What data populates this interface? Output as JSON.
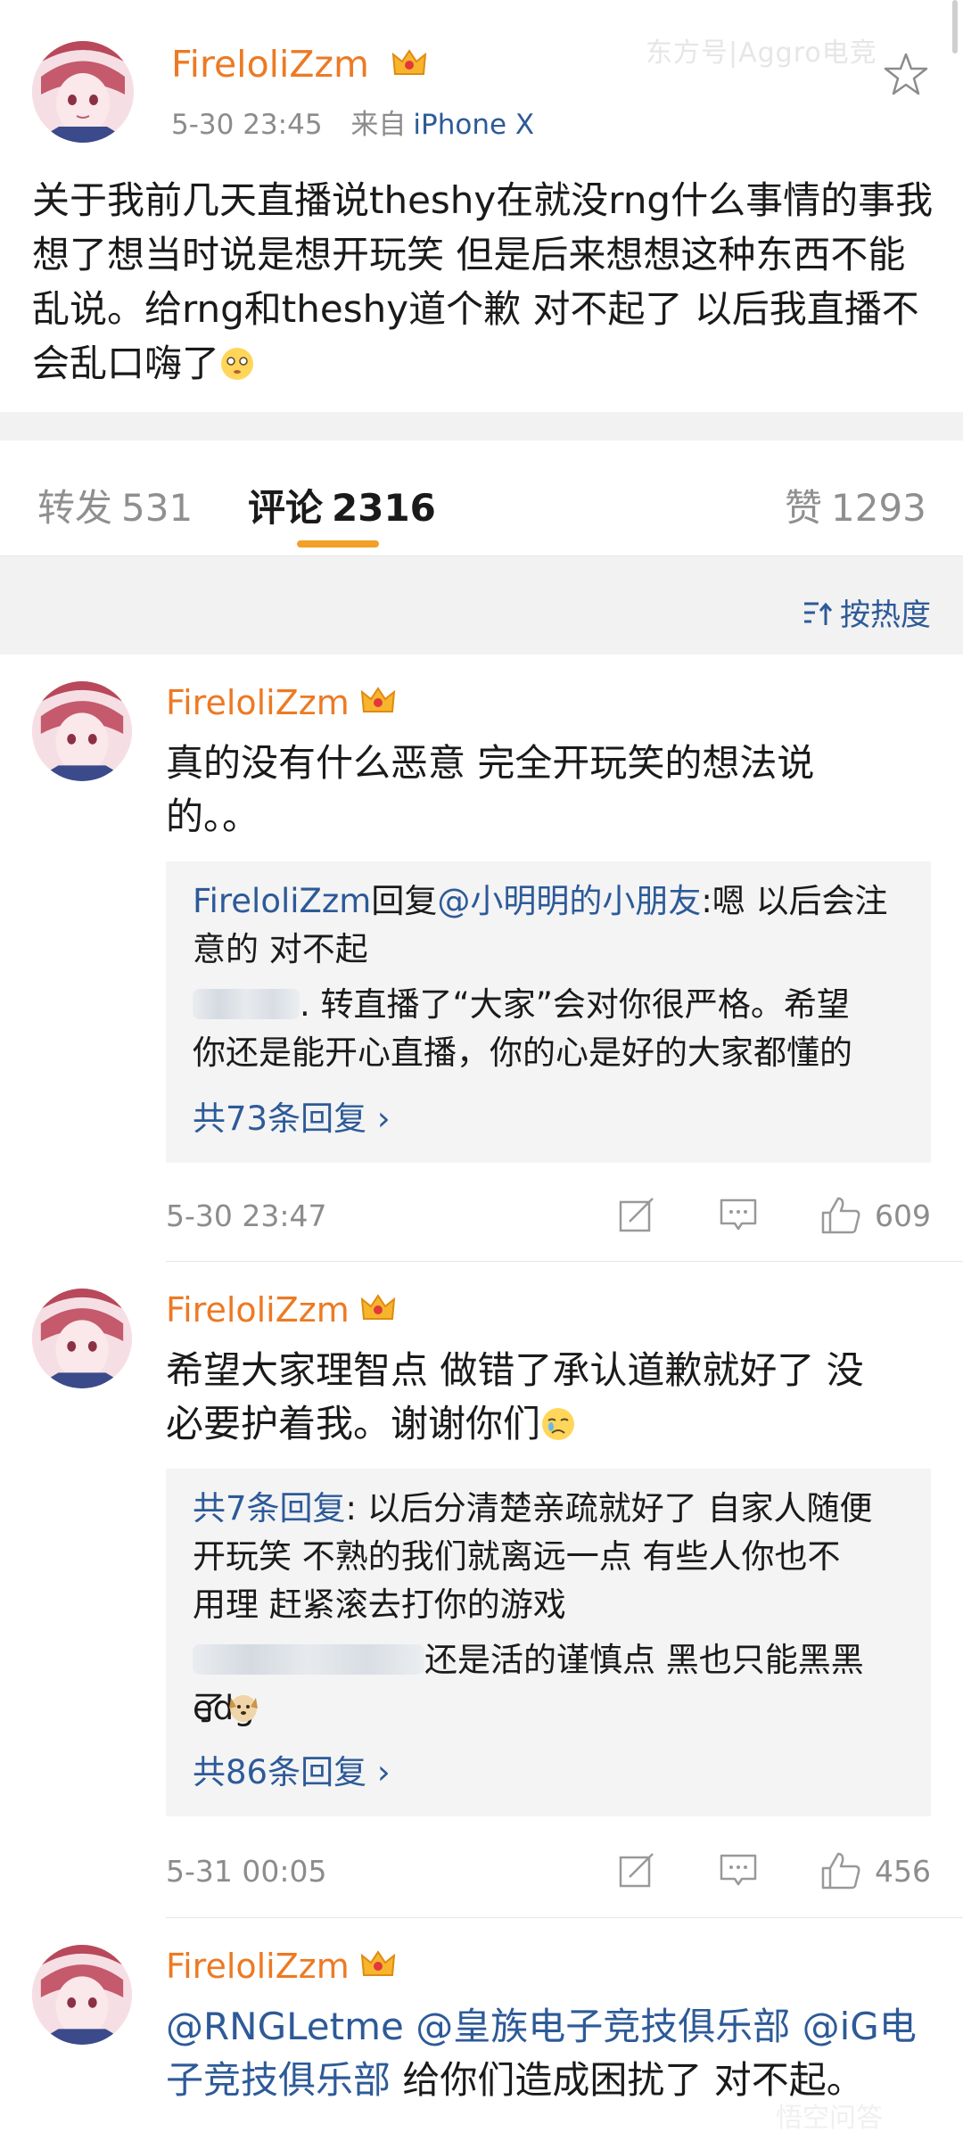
{
  "watermark": "东方号|Aggro电竞",
  "watermark_bottom": "悟空问答",
  "post": {
    "username": "FireloliZzm",
    "time": "5-30 23:45",
    "source_prefix": "来自",
    "device": "iPhone X",
    "text": "关于我前几天直播说theshy在就没rng什么事情的事我想了想当时说是想开玩笑 但是后来想想这种东西不能乱说。给rng和theshy道个歉 对不起了 以后我直播不会乱口嗨了"
  },
  "tabs": [
    {
      "label": "转发",
      "count": "531"
    },
    {
      "label": "评论",
      "count": "2316"
    },
    {
      "label": "赞",
      "count": "1293"
    }
  ],
  "sort": {
    "label": "按热度"
  },
  "comments": [
    {
      "username": "FireloliZzm",
      "text_line1": "真的没有什么恶意 完全开玩笑的想法说",
      "text_line2": "的。。",
      "reply1_name": "FireloliZzm",
      "reply1_mid": "回复",
      "reply1_mention": "@小明明的小朋友",
      "reply1_text1": ":嗯 以后会注",
      "reply1_text2": "意的 对不起",
      "reply2_text1": ". 转直播了“大家”会对你很严格。希望",
      "reply2_text2": "你还是能开心直播，你的心是好的大家都懂的",
      "more": "共73条回复",
      "time": "5-30 23:47",
      "likes": "609"
    },
    {
      "username": "FireloliZzm",
      "text_line1": "希望大家理智点 做错了承认道歉就好了 没",
      "text_line2": "必要护着我。谢谢你们",
      "reply1_link": "共7条回复",
      "reply1_text1": ": 以后分清楚亲疏就好了 自家人随便",
      "reply1_text2": "开玩笑 不熟的我们就离远一点 有些人你也不",
      "reply1_text3": "用理 赶紧滚去打你的游戏",
      "reply2_text1": "还是活的谨慎点 黑也只能黑黑edg",
      "reply2_text2": "了",
      "more": "共86条回复",
      "time": "5-31 00:05",
      "likes": "456"
    },
    {
      "username": "FireloliZzm",
      "mention1": "@RNGLetme",
      "mention2": "@皇族电子竞技俱乐部",
      "mention3a": "@iG电",
      "mention3b": "子竞技俱乐部",
      "text_tail": "给你们造成困扰了 对不起。"
    }
  ],
  "colors": {
    "accent_orange": "#ec7a24",
    "link_blue": "#2d5a98",
    "tab_indicator": "#f3a028",
    "background_gray": "#f2f2f2"
  },
  "icons": [
    "crown-vip-icon",
    "star-favorite-icon",
    "sort-icon",
    "repost-icon",
    "comment-icon",
    "like-icon",
    "chevron-right-icon",
    "flushed-emoji-icon",
    "sad-emoji-icon",
    "dog-emoji-icon"
  ]
}
